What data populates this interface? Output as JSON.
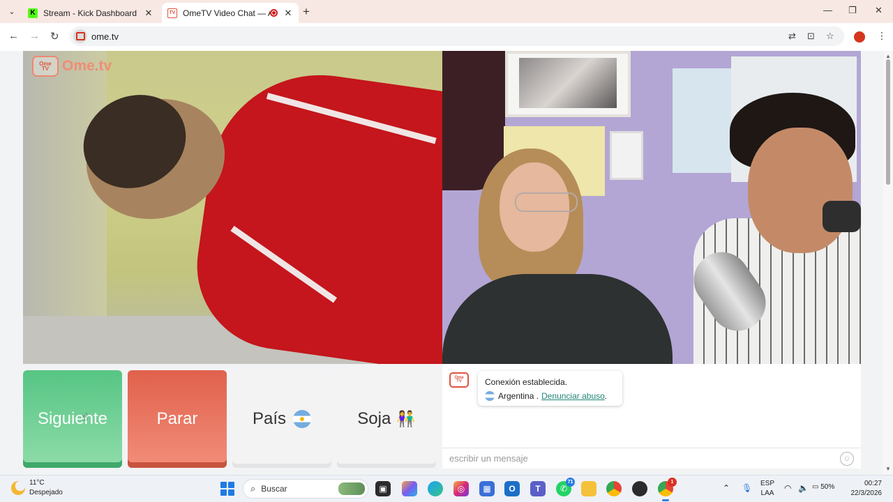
{
  "browser": {
    "tabs": [
      {
        "title": "Stream - Kick Dashboard",
        "favicon": "kick-icon",
        "favicon_letter": "K",
        "active": false
      },
      {
        "title": "OmeTV Video Chat — Alte",
        "favicon": "ometv-icon",
        "active": true,
        "recording": true
      }
    ],
    "url": "ome.tv",
    "new_tab_symbol": "+",
    "close_symbol": "✕"
  },
  "page": {
    "logo_text": "Ome.tv",
    "logo_badge": "Ome\nTV",
    "buttons": {
      "next": "Siguiente",
      "stop": "Parar",
      "country": "País",
      "gender": "Soja"
    },
    "country_flag": "Argentina",
    "chat": {
      "system_message": "Conexión establecida.",
      "country": "Argentina",
      "separator": ".",
      "report_link": "Denunciar abuso",
      "report_suffix": ".",
      "input_placeholder": "escribir un mensaje"
    }
  },
  "taskbar": {
    "weather_temp": "11°C",
    "weather_desc": "Despejado",
    "search_label": "Buscar",
    "apps": [
      {
        "name": "file-explorer-icon",
        "color": "#f4b400"
      },
      {
        "name": "copilot-icon",
        "color": "#7a5cf0"
      },
      {
        "name": "edge-icon",
        "color": "#1da1f2"
      },
      {
        "name": "instagram-icon",
        "color": "#d6287a"
      },
      {
        "name": "store-icon",
        "color": "#3a6fd8"
      },
      {
        "name": "outlook-icon",
        "color": "#1b6fc8"
      },
      {
        "name": "teams-icon",
        "color": "#5b5fc7"
      },
      {
        "name": "whatsapp-icon",
        "color": "#25d366",
        "badge": "71"
      },
      {
        "name": "folder-icon",
        "color": "#f5c13a"
      },
      {
        "name": "chrome-icon",
        "color": "#e54335"
      },
      {
        "name": "obs-icon",
        "color": "#2b2b2b"
      },
      {
        "name": "chrome-alt-icon",
        "color": "#34a853",
        "badge": "1"
      }
    ],
    "lang_top": "ESP",
    "lang_bottom": "LAA",
    "battery": "50%",
    "time": "00:27",
    "date": "22/3/2026"
  }
}
